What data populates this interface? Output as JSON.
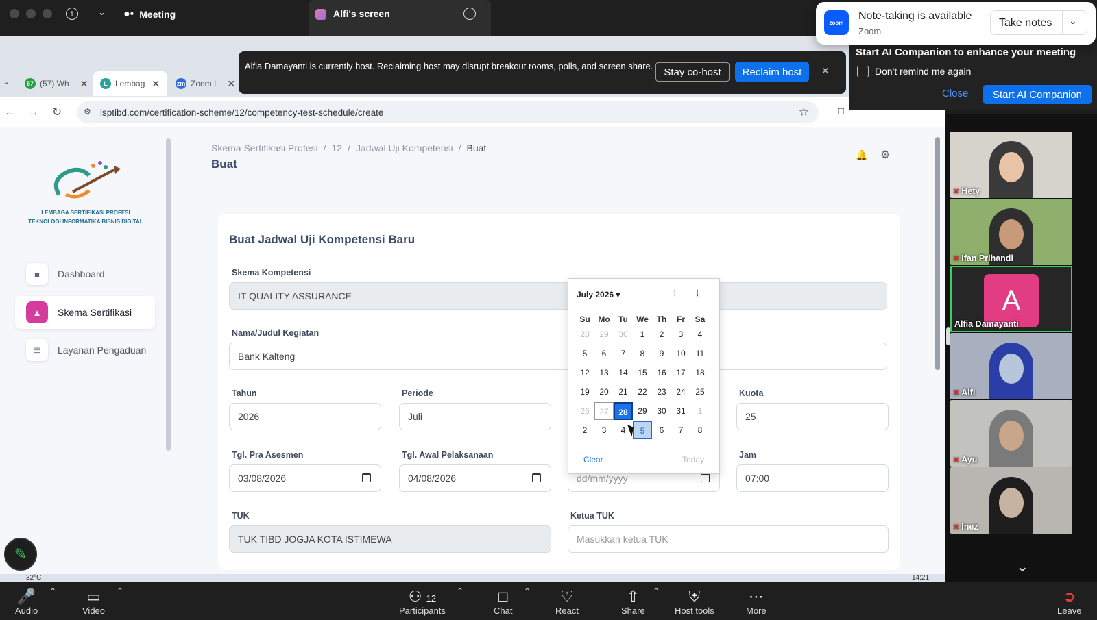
{
  "zoom": {
    "meeting_label": "Meeting",
    "screen_title": "Alfi's screen",
    "note_popup": {
      "title": "Note-taking is available",
      "subtitle": "Zoom",
      "take_notes": "Take notes",
      "logo_text": "zoom"
    },
    "ai_panel": {
      "heading": "Start AI Companion to enhance your meeting",
      "checkbox_label": "Don't remind me again",
      "close": "Close",
      "start": "Start AI Companion"
    },
    "host_banner": {
      "text": "Alfia Damayanti is currently host. Reclaiming host may disrupt breakout rooms, polls, and screen share.",
      "stay": "Stay co-host",
      "reclaim": "Reclaim host"
    },
    "participants": [
      {
        "name": "Hety",
        "muted": true
      },
      {
        "name": "Ifan Prihandi",
        "muted": true
      },
      {
        "name": "Alfia Damayanti",
        "muted": false,
        "initial": "A",
        "active": true
      },
      {
        "name": "Alfi",
        "muted": true
      },
      {
        "name": "Ayu",
        "muted": true
      },
      {
        "name": "Inez",
        "muted": true
      }
    ],
    "toolbar": {
      "audio": "Audio",
      "video": "Video",
      "participants": "Participants",
      "participants_count": "12",
      "chat": "Chat",
      "react": "React",
      "share": "Share",
      "host_tools": "Host tools",
      "more": "More",
      "leave": "Leave"
    }
  },
  "browser": {
    "tabs": [
      {
        "label": "(57) Wh",
        "favicon": "57",
        "color": "#25a244"
      },
      {
        "label": "Lembag",
        "favicon": "L",
        "color": "#2aa39a",
        "active": true
      },
      {
        "label": "Zoom I",
        "favicon": "zm",
        "color": "#2d6cdf"
      }
    ],
    "url": "lsptibd.com/certification-scheme/12/competency-test-schedule/create",
    "taskbar_temp": "32°C",
    "taskbar_time": "14:21"
  },
  "app": {
    "logo_line1": "LEMBAGA SERTIFIKASI PROFESI",
    "logo_line2": "TEKNOLOGI INFORMATIKA BISNIS DIGITAL",
    "sidebar": [
      {
        "label": "Dashboard",
        "icon": "dashboard-icon"
      },
      {
        "label": "Skema Sertifikasi",
        "icon": "hierarchy-icon",
        "active": true
      },
      {
        "label": "Layanan Pengaduan",
        "icon": "inbox-icon"
      }
    ],
    "breadcrumb": [
      "Skema Sertifikasi Profesi",
      "12",
      "Jadwal Uji Kompetensi",
      "Buat"
    ],
    "page_title": "Buat",
    "form": {
      "title": "Buat Jadwal Uji Kompetensi Baru",
      "skema_label": "Skema Kompetensi",
      "skema_value": "IT QUALITY  ASSURANCE",
      "nama_label": "Nama/Judul Kegiatan",
      "nama_value": "Bank Kalteng",
      "tahun_label": "Tahun",
      "tahun_value": "2026",
      "periode_label": "Periode",
      "periode_value": "Juli",
      "kuota_label": "Kuota",
      "kuota_value": "25",
      "pra_label": "Tgl. Pra Asesmen",
      "pra_value": "03/08/2026",
      "awal_label": "Tgl. Awal Pelaksanaan",
      "awal_value": "04/08/2026",
      "akhir_placeholder": "dd/mm/yyyy",
      "jam_label": "Jam",
      "jam_value": "07:00",
      "tuk_label": "TUK",
      "tuk_value": "TUK TIBD JOGJA KOTA ISTIMEWA",
      "ketua_label": "Ketua TUK",
      "ketua_placeholder": "Masukkan ketua TUK"
    },
    "datepicker": {
      "month": "July 2026",
      "weekdays": [
        "Su",
        "Mo",
        "Tu",
        "We",
        "Th",
        "Fr",
        "Sa"
      ],
      "weeks": [
        [
          "28",
          "29",
          "30",
          "1",
          "2",
          "3",
          "4"
        ],
        [
          "5",
          "6",
          "7",
          "8",
          "9",
          "10",
          "11"
        ],
        [
          "12",
          "13",
          "14",
          "15",
          "16",
          "17",
          "18"
        ],
        [
          "19",
          "20",
          "21",
          "22",
          "23",
          "24",
          "25"
        ],
        [
          "26",
          "27",
          "28",
          "29",
          "30",
          "31",
          "1"
        ],
        [
          "2",
          "3",
          "4",
          "5",
          "6",
          "7",
          "8"
        ]
      ],
      "clear": "Clear",
      "today": "Today"
    }
  }
}
